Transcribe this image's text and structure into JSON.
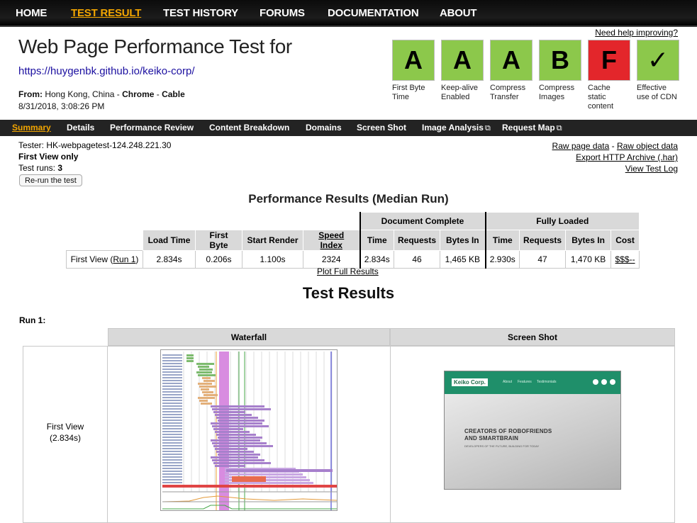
{
  "nav": {
    "items": [
      {
        "label": "HOME"
      },
      {
        "label": "TEST RESULT"
      },
      {
        "label": "TEST HISTORY"
      },
      {
        "label": "FORUMS"
      },
      {
        "label": "DOCUMENTATION"
      },
      {
        "label": "ABOUT"
      }
    ],
    "active": "TEST RESULT"
  },
  "header": {
    "title": "Web Page Performance Test for",
    "url": "https://huygenbk.github.io/keiko-corp/",
    "from_label": "From:",
    "from_location": "Hong Kong, China - ",
    "browser": "Chrome",
    "sep": " - ",
    "connection": "Cable",
    "date": "8/31/2018, 3:08:26 PM",
    "help_link": "Need help improving?"
  },
  "grades": [
    {
      "grade": "A",
      "label": "First Byte Time",
      "color": "#8cc84b"
    },
    {
      "grade": "A",
      "label": "Keep-alive Enabled",
      "color": "#8cc84b"
    },
    {
      "grade": "A",
      "label": "Compress Transfer",
      "color": "#8cc84b"
    },
    {
      "grade": "B",
      "label": "Compress Images",
      "color": "#8cc84b"
    },
    {
      "grade": "F",
      "label": "Cache static content",
      "color": "#e3262b"
    },
    {
      "grade": "✓",
      "label": "Effective use of CDN",
      "color": "#8cc84b"
    }
  ],
  "subnav": {
    "items": [
      {
        "label": "Summary"
      },
      {
        "label": "Details"
      },
      {
        "label": "Performance Review"
      },
      {
        "label": "Content Breakdown"
      },
      {
        "label": "Domains"
      },
      {
        "label": "Screen Shot"
      },
      {
        "label": "Image Analysis"
      },
      {
        "label": "Request Map"
      }
    ],
    "active": "Summary"
  },
  "info": {
    "tester": "Tester: HK-webpagetest-124.248.221.30",
    "first_view_only": "First View only",
    "test_runs_label": "Test runs: ",
    "test_runs": "3",
    "rerun_button": "Re-run the test"
  },
  "links": {
    "raw_page_data": "Raw page data",
    "dash": " - ",
    "raw_object_data": "Raw object data",
    "export_har": "Export HTTP Archive (.har)",
    "view_test_log": "View Test Log"
  },
  "performance": {
    "title": "Performance Results (Median Run)",
    "group_headers": [
      "Document Complete",
      "Fully Loaded"
    ],
    "columns": [
      "Load Time",
      "First Byte",
      "Start Render",
      "Speed Index",
      "Time",
      "Requests",
      "Bytes In",
      "Time",
      "Requests",
      "Bytes In",
      "Cost"
    ],
    "row": {
      "label": "First View (",
      "run_link": "Run 1",
      "label_end": ")",
      "values": [
        "2.834s",
        "0.206s",
        "1.100s",
        "2324",
        "2.834s",
        "46",
        "1,465 KB",
        "2.930s",
        "47",
        "1,470 KB",
        "$$$--"
      ]
    },
    "plot_link": "Plot Full Results"
  },
  "results": {
    "title": "Test Results",
    "run_label": "Run 1:",
    "columns": [
      "Waterfall",
      "Screen Shot"
    ],
    "first_view": "First View",
    "first_view_time": "(2.834s)"
  },
  "screenshot": {
    "brand": "Keiko Corp.",
    "menu": [
      "About",
      "Features",
      "Testimonials"
    ],
    "headline_1": "CREATORS OF ROBOFRIENDS",
    "headline_2": "AND SMARTBRAIN",
    "subline": "DEVELOPERS OF THE FUTURE, BUILDING FOR TODAY"
  }
}
